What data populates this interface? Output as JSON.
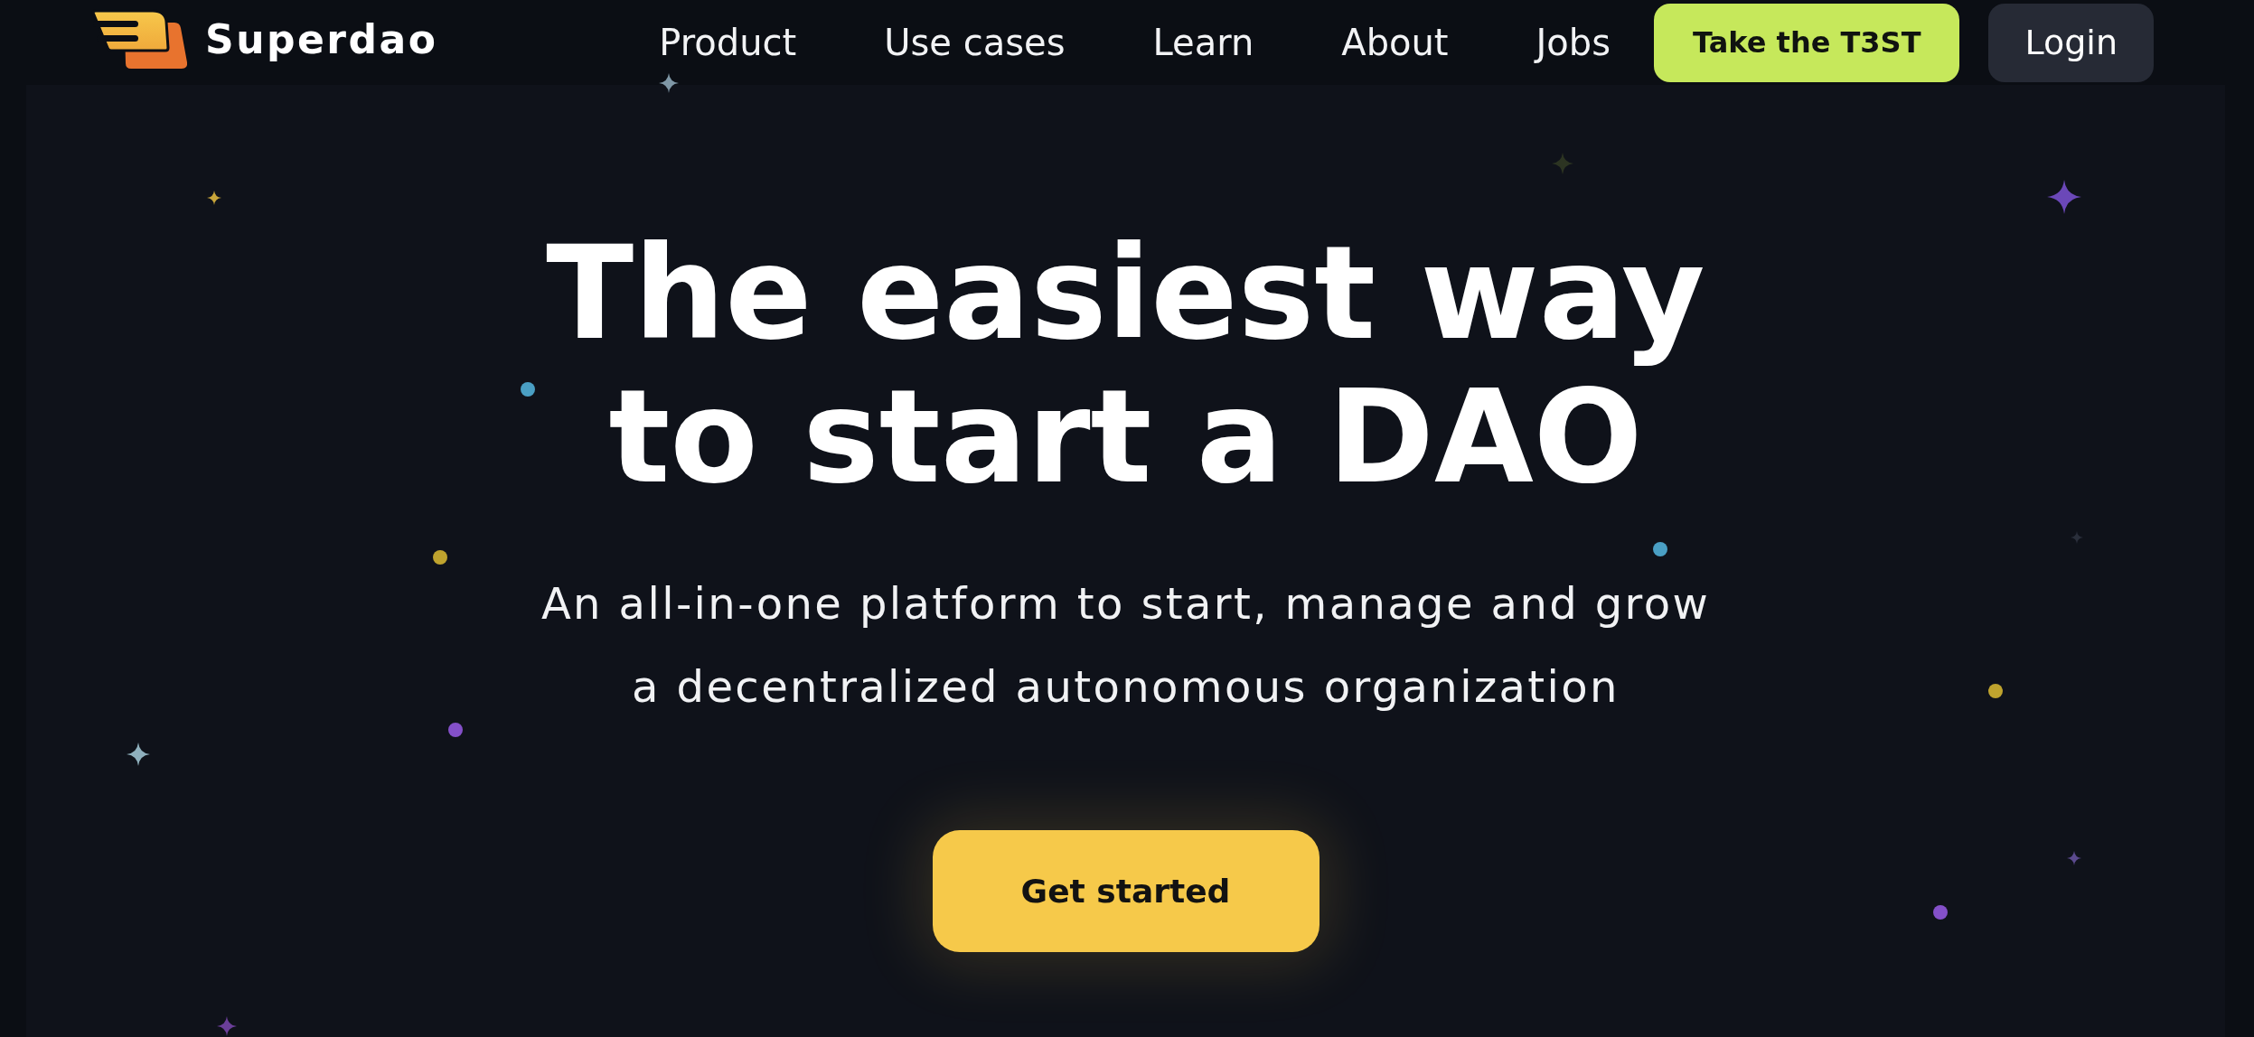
{
  "header": {
    "brand": "Superdao",
    "nav": [
      {
        "label": "Product"
      },
      {
        "label": "Use cases"
      },
      {
        "label": "Learn"
      },
      {
        "label": "About"
      },
      {
        "label": "Jobs"
      }
    ],
    "buttons": [
      {
        "label": "Take the T3ST",
        "kind": "primary"
      },
      {
        "label": "Login",
        "kind": "secondary"
      }
    ]
  },
  "hero": {
    "title_lines": [
      "The easiest way",
      "to start a DAO"
    ],
    "subtitle_lines": [
      "An all-in-one platform to start, manage and grow",
      "a decentralized autonomous organization"
    ],
    "cta": {
      "label": "Get started"
    }
  }
}
